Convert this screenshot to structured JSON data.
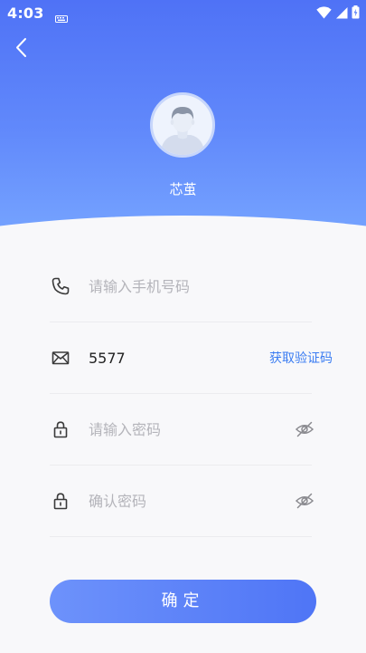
{
  "status_bar": {
    "time": "4:03",
    "keyboard_icon": "keyboard-icon",
    "wifi_icon": "wifi-icon",
    "signal_icon": "signal-icon",
    "battery_icon": "battery-icon"
  },
  "header": {
    "back_icon": "chevron-left-icon",
    "username": "芯茧",
    "gradient_colors": [
      "#4f72f6",
      "#76a4ff"
    ]
  },
  "form": {
    "phone": {
      "icon": "phone-icon",
      "value": "",
      "placeholder": "请输入手机号码"
    },
    "code": {
      "icon": "mail-icon",
      "value": "5577",
      "placeholder": "",
      "action_label": "获取验证码"
    },
    "password": {
      "icon": "lock-icon",
      "value": "",
      "placeholder": "请输入密码",
      "toggle_icon": "eye-off-icon"
    },
    "confirm_password": {
      "icon": "lock-icon",
      "value": "",
      "placeholder": "确认密码",
      "toggle_icon": "eye-off-icon"
    }
  },
  "submit": {
    "label": "确定",
    "color": "#5a7ff8"
  }
}
